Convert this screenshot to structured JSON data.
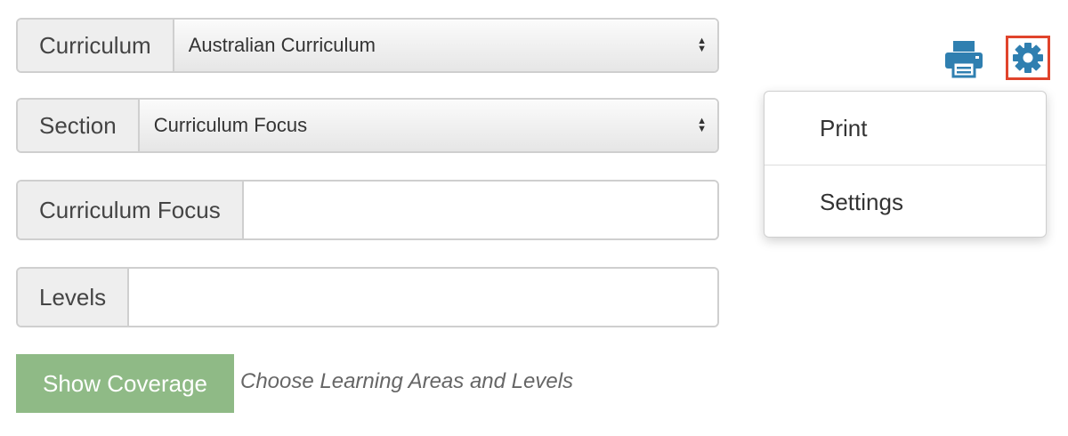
{
  "form": {
    "curriculum": {
      "label": "Curriculum",
      "selected": "Australian Curriculum"
    },
    "section": {
      "label": "Section",
      "selected": "Curriculum Focus"
    },
    "curriculum_focus": {
      "label": "Curriculum Focus",
      "value": ""
    },
    "levels": {
      "label": "Levels",
      "value": ""
    }
  },
  "actions": {
    "show_coverage_label": "Show Coverage",
    "hint": "Choose Learning Areas and Levels"
  },
  "toolbar": {
    "print_icon": "printer-icon",
    "settings_icon": "gear-icon",
    "accent_color": "#2f7fb0",
    "highlight_color": "#e0442c"
  },
  "dropdown_menu": {
    "items": [
      {
        "label": "Print"
      },
      {
        "label": "Settings"
      }
    ]
  }
}
